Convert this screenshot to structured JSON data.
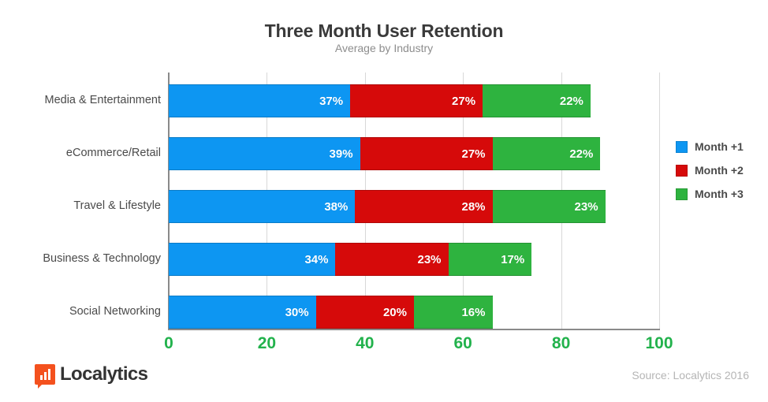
{
  "chart_data": {
    "type": "bar",
    "orientation": "horizontal",
    "stacked": true,
    "title": "Three Month User Retention",
    "subtitle": "Average  by Industry",
    "xlabel": "",
    "ylabel": "",
    "xlim": [
      0,
      100
    ],
    "xticks": [
      "0",
      "20",
      "40",
      "60",
      "80",
      "100"
    ],
    "xtick_values": [
      0,
      20,
      40,
      60,
      80,
      100
    ],
    "grid": true,
    "legend_position": "right",
    "categories": [
      "Media & Entertainment",
      "eCommerce/Retail",
      "Travel & Lifestyle",
      "Business & Technology",
      "Social Networking"
    ],
    "series": [
      {
        "name": "Month +1",
        "color": "#0d96f2",
        "values": [
          37,
          39,
          38,
          34,
          30
        ],
        "labels": [
          "37%",
          "39%",
          "38%",
          "34%",
          "30%"
        ]
      },
      {
        "name": "Month +2",
        "color": "#d60a0a",
        "values": [
          27,
          27,
          28,
          23,
          20
        ],
        "labels": [
          "27%",
          "27%",
          "28%",
          "23%",
          "20%"
        ]
      },
      {
        "name": "Month +3",
        "color": "#2eb33f",
        "values": [
          22,
          22,
          23,
          17,
          16
        ],
        "labels": [
          "22%",
          "22%",
          "23%",
          "17%",
          "16%"
        ]
      }
    ],
    "totals": [
      86,
      88,
      89,
      74,
      66
    ],
    "colors": {
      "month1": "#0d96f2",
      "month2": "#d60a0a",
      "month3": "#2eb33f",
      "xtick": "#22b24c",
      "title": "#3a3a3a",
      "subtitle": "#8d8d8d",
      "category_label": "#4a4a4a",
      "axis": "#8a8a8a",
      "gridline": "#d8d8d8",
      "brand": "#f4511e",
      "source": "#b5b5b5"
    }
  },
  "legend": {
    "items": [
      {
        "label": "Month +1",
        "color": "#0d96f2"
      },
      {
        "label": "Month +2",
        "color": "#d60a0a"
      },
      {
        "label": "Month +3",
        "color": "#2eb33f"
      }
    ]
  },
  "footer": {
    "brand_name": "Localytics",
    "source_text": "Source: Localytics  2016"
  }
}
